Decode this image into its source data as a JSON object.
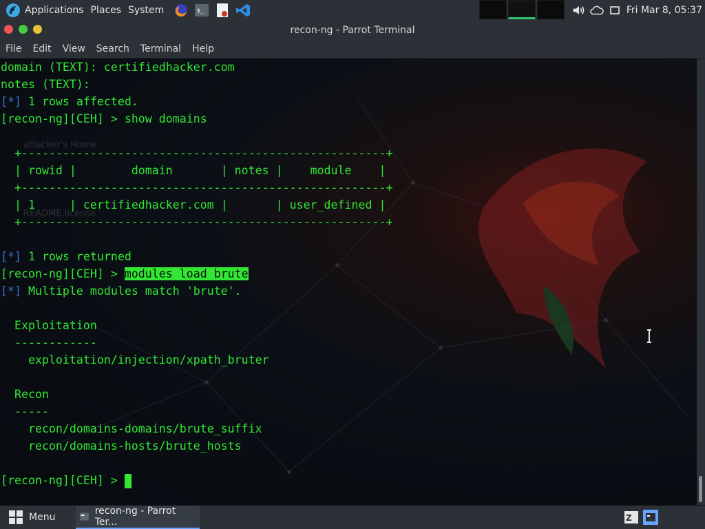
{
  "top_panel": {
    "menus": [
      "Applications",
      "Places",
      "System"
    ],
    "launchers": [
      "firefox-icon",
      "terminal-icon",
      "text-editor-icon",
      "vscode-icon"
    ],
    "clock": "Fri Mar  8, 05:37"
  },
  "window": {
    "title": "recon-ng - Parrot Terminal",
    "menu": [
      "File",
      "Edit",
      "View",
      "Search",
      "Terminal",
      "Help"
    ]
  },
  "desktop": {
    "labels": [
      "attacker's Home",
      "README.license"
    ]
  },
  "terminal": {
    "lines": [
      {
        "kind": "plain",
        "text": "domain (TEXT): certifiedhacker.com"
      },
      {
        "kind": "plain",
        "text": "notes (TEXT):"
      },
      {
        "kind": "status",
        "tag": "[*]",
        "text": " 1 rows affected."
      },
      {
        "kind": "prompt",
        "prompt": "[recon-ng][CEH] > ",
        "cmd": "show domains"
      },
      {
        "kind": "plain",
        "text": ""
      },
      {
        "kind": "plain",
        "text": "  +-----------------------------------------------------+"
      },
      {
        "kind": "plain",
        "text": "  | rowid |        domain       | notes |    module    |"
      },
      {
        "kind": "plain",
        "text": "  +-----------------------------------------------------+"
      },
      {
        "kind": "plain",
        "text": "  | 1     | certifiedhacker.com |       | user_defined |"
      },
      {
        "kind": "plain",
        "text": "  +-----------------------------------------------------+"
      },
      {
        "kind": "plain",
        "text": ""
      },
      {
        "kind": "status",
        "tag": "[*]",
        "text": " 1 rows returned"
      },
      {
        "kind": "prompt-hl",
        "prompt": "[recon-ng][CEH] > ",
        "cmd": "modules load brute"
      },
      {
        "kind": "status",
        "tag": "[*]",
        "text": " Multiple modules match 'brute'."
      },
      {
        "kind": "plain",
        "text": ""
      },
      {
        "kind": "plain",
        "text": "  Exploitation"
      },
      {
        "kind": "plain",
        "text": "  ------------"
      },
      {
        "kind": "plain",
        "text": "    exploitation/injection/xpath_bruter"
      },
      {
        "kind": "plain",
        "text": ""
      },
      {
        "kind": "plain",
        "text": "  Recon"
      },
      {
        "kind": "plain",
        "text": "  -----"
      },
      {
        "kind": "plain",
        "text": "    recon/domains-domains/brute_suffix"
      },
      {
        "kind": "plain",
        "text": "    recon/domains-hosts/brute_hosts"
      },
      {
        "kind": "plain",
        "text": ""
      },
      {
        "kind": "cursor",
        "prompt": "[recon-ng][CEH] > "
      }
    ]
  },
  "taskbar": {
    "menu_label": "Menu",
    "task_label": "recon-ng - Parrot Ter..."
  },
  "colors": {
    "terminal_green": "#33e633",
    "status_blue": "#3b6fd1",
    "panel_bg": "#2b3137"
  }
}
